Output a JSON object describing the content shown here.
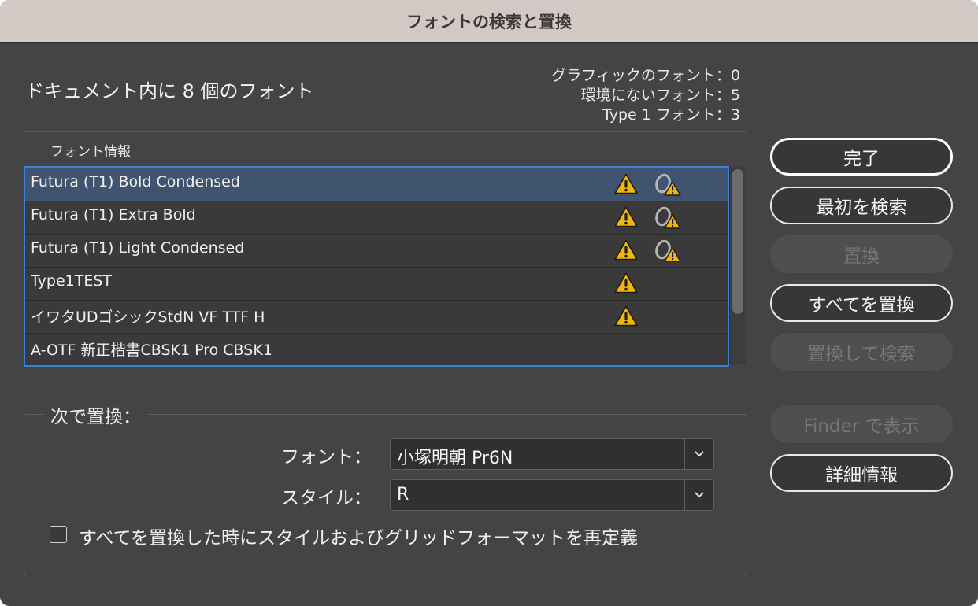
{
  "window": {
    "title": "フォントの検索と置換"
  },
  "summary": {
    "document_fonts": "ドキュメント内に 8 個のフォント",
    "stats": [
      "グラフィックのフォント：0",
      "環境にないフォント：5",
      "Type 1 フォント：3"
    ]
  },
  "font_list": {
    "label": "フォント情報",
    "rows": [
      {
        "name": "Futura (T1) Bold Condensed",
        "warning": true,
        "type1": true,
        "selected": true
      },
      {
        "name": "Futura (T1) Extra Bold",
        "warning": true,
        "type1": true,
        "selected": false
      },
      {
        "name": "Futura (T1) Light Condensed",
        "warning": true,
        "type1": true,
        "selected": false
      },
      {
        "name": "Type1TEST",
        "warning": true,
        "type1": false,
        "selected": false
      },
      {
        "name": "イワタUDゴシックStdN VF TTF H",
        "warning": true,
        "type1": false,
        "selected": false
      },
      {
        "name": "A-OTF 新正楷書CBSK1 Pro CBSK1",
        "warning": false,
        "type1": false,
        "selected": false
      }
    ]
  },
  "replace": {
    "group_title": "次で置換：",
    "font_label": "フォント：",
    "font_value": "小塚明朝 Pr6N",
    "style_label": "スタイル：",
    "style_value": "R",
    "redefine_label": "すべてを置換した時にスタイルおよびグリッドフォーマットを再定義",
    "redefine_checked": false
  },
  "buttons": {
    "done": "完了",
    "find_first": "最初を検索",
    "change": "置換",
    "change_all": "すべてを置換",
    "change_find": "置換して検索",
    "reveal_finder": "Finder で表示",
    "more_info": "詳細情報"
  },
  "colors": {
    "window_bg": "#444444",
    "titlebar_bg": "#d3c8c4",
    "selection": "#405470",
    "focus_ring": "#3b82d6",
    "warning": "#f2b705"
  }
}
